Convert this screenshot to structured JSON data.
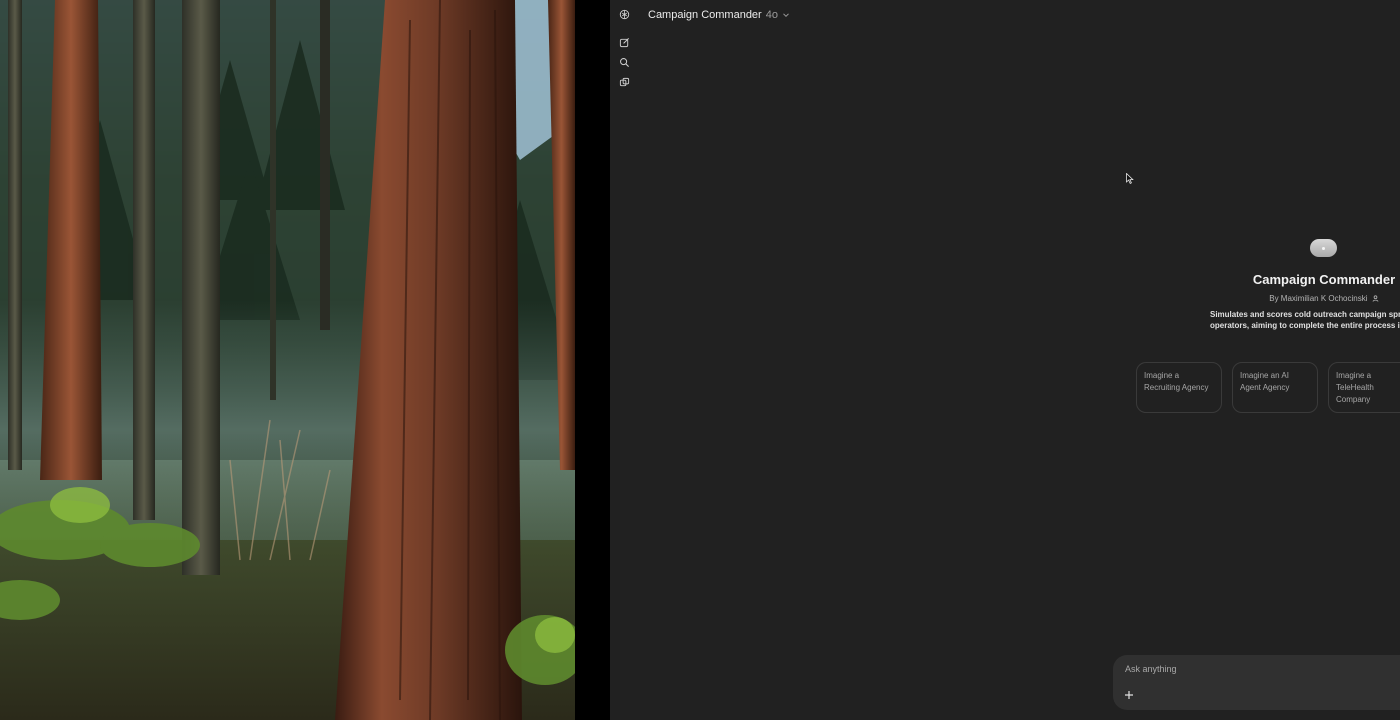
{
  "wallpaper": {
    "icon": "forest-photo"
  },
  "app": {
    "header": {
      "title": "Campaign Commander",
      "model": "4o",
      "chevron_icon": "chevron-down-icon"
    },
    "rail": {
      "items": [
        {
          "icon": "openai-logo-icon"
        },
        {
          "icon": "new-chat-icon"
        },
        {
          "icon": "search-icon"
        },
        {
          "icon": "library-icon"
        }
      ]
    },
    "hero": {
      "title": "Campaign Commander",
      "by": "By Maximilian K Ochocinski",
      "desc_line1": "Simulates and scores cold outreach campaign sprints",
      "desc_line2": "operators, aiming to complete the entire process in un"
    },
    "starters": [
      "Imagine a Recruiting Agency",
      "Imagine an AI Agent Agency",
      "Imagine a TeleHealth Company"
    ],
    "composer": {
      "placeholder": "Ask anything",
      "plus_icon": "plus-icon"
    },
    "colors": {
      "background": "#212121",
      "composer": "#303030",
      "text": "#ececec",
      "muted": "#9b9b9b"
    }
  }
}
